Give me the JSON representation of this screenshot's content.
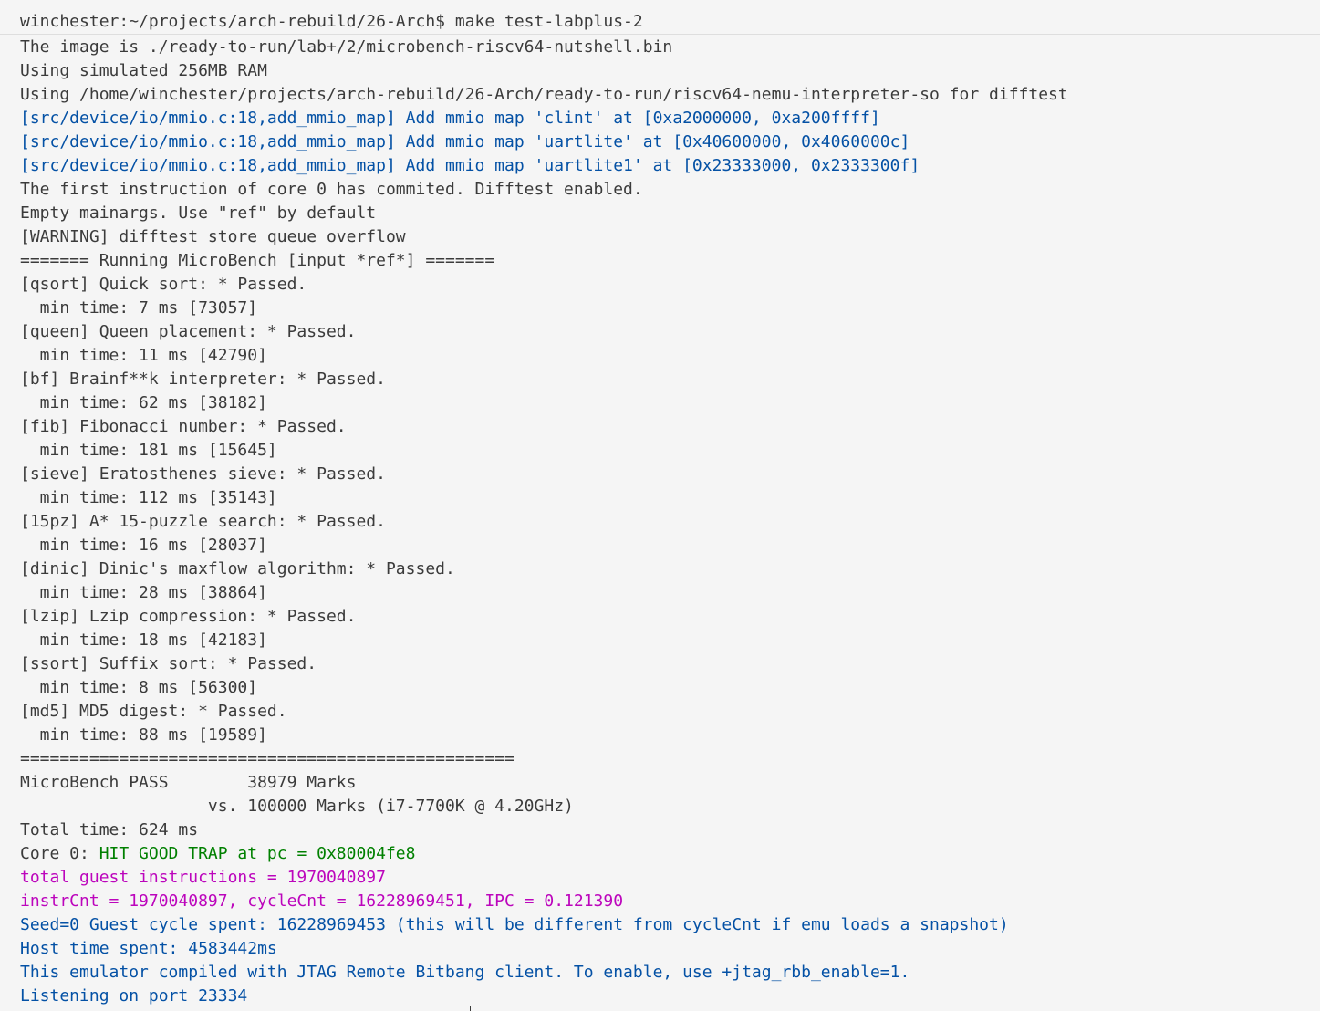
{
  "terminal": {
    "prompt": "winchester:~/projects/arch-rebuild/26-Arch$ make test-labplus-2",
    "lines": [
      {
        "text": "The image is ./ready-to-run/lab+/2/microbench-riscv64-nutshell.bin",
        "style": "default"
      },
      {
        "text": "Using simulated 256MB RAM",
        "style": "default"
      },
      {
        "text": "Using /home/winchester/projects/arch-rebuild/26-Arch/ready-to-run/riscv64-nemu-interpreter-so for difftest",
        "style": "default"
      },
      {
        "text": "[src/device/io/mmio.c:18,add_mmio_map] Add mmio map 'clint' at [0xa2000000, 0xa200ffff]",
        "style": "blue"
      },
      {
        "text": "[src/device/io/mmio.c:18,add_mmio_map] Add mmio map 'uartlite' at [0x40600000, 0x4060000c]",
        "style": "blue"
      },
      {
        "text": "[src/device/io/mmio.c:18,add_mmio_map] Add mmio map 'uartlite1' at [0x23333000, 0x2333300f]",
        "style": "blue"
      },
      {
        "text": "The first instruction of core 0 has commited. Difftest enabled.",
        "style": "default"
      },
      {
        "text": "Empty mainargs. Use \"ref\" by default",
        "style": "default"
      },
      {
        "text": "[WARNING] difftest store queue overflow",
        "style": "default"
      },
      {
        "text": "======= Running MicroBench [input *ref*] =======",
        "style": "default"
      },
      {
        "text": "[qsort] Quick sort: * Passed.",
        "style": "default"
      },
      {
        "text": "  min time: 7 ms [73057]",
        "style": "default"
      },
      {
        "text": "[queen] Queen placement: * Passed.",
        "style": "default"
      },
      {
        "text": "  min time: 11 ms [42790]",
        "style": "default"
      },
      {
        "text": "[bf] Brainf**k interpreter: * Passed.",
        "style": "default"
      },
      {
        "text": "  min time: 62 ms [38182]",
        "style": "default"
      },
      {
        "text": "[fib] Fibonacci number: * Passed.",
        "style": "default"
      },
      {
        "text": "  min time: 181 ms [15645]",
        "style": "default"
      },
      {
        "text": "[sieve] Eratosthenes sieve: * Passed.",
        "style": "default"
      },
      {
        "text": "  min time: 112 ms [35143]",
        "style": "default"
      },
      {
        "text": "[15pz] A* 15-puzzle search: * Passed.",
        "style": "default"
      },
      {
        "text": "  min time: 16 ms [28037]",
        "style": "default"
      },
      {
        "text": "[dinic] Dinic's maxflow algorithm: * Passed.",
        "style": "default"
      },
      {
        "text": "  min time: 28 ms [38864]",
        "style": "default"
      },
      {
        "text": "[lzip] Lzip compression: * Passed.",
        "style": "default"
      },
      {
        "text": "  min time: 18 ms [42183]",
        "style": "default"
      },
      {
        "text": "[ssort] Suffix sort: * Passed.",
        "style": "default"
      },
      {
        "text": "  min time: 8 ms [56300]",
        "style": "default"
      },
      {
        "text": "[md5] MD5 digest: * Passed.",
        "style": "default"
      },
      {
        "text": "  min time: 88 ms [19589]",
        "style": "default"
      },
      {
        "text": "==================================================",
        "style": "default"
      },
      {
        "text": "MicroBench PASS        38979 Marks",
        "style": "default"
      },
      {
        "text": "                   vs. 100000 Marks (i7-7700K @ 4.20GHz)",
        "style": "default"
      },
      {
        "text": "Total time: 624 ms",
        "style": "default"
      },
      {
        "segments": [
          {
            "text": "Core 0: ",
            "style": "default"
          },
          {
            "text": "HIT GOOD TRAP at pc = 0x80004fe8",
            "style": "green"
          }
        ]
      },
      {
        "text": "total guest instructions = 1970040897",
        "style": "magenta"
      },
      {
        "text": "instrCnt = 1970040897, cycleCnt = 16228969451, IPC = 0.121390",
        "style": "magenta"
      },
      {
        "text": "Seed=0 Guest cycle spent: 16228969453 (this will be different from cycleCnt if emu loads a snapshot)",
        "style": "blue"
      },
      {
        "text": "Host time spent: 4583442ms",
        "style": "blue"
      },
      {
        "text": "This emulator compiled with JTAG Remote Bitbang client. To enable, use +jtag_rbb_enable=1.",
        "style": "blue"
      },
      {
        "text": "Listening on port 23334",
        "style": "blue"
      }
    ],
    "colors": {
      "default": "#3b3b3b",
      "blue": "#0451a5",
      "green": "#008000",
      "magenta": "#bc05bc",
      "background": "#f5f5f5"
    }
  }
}
